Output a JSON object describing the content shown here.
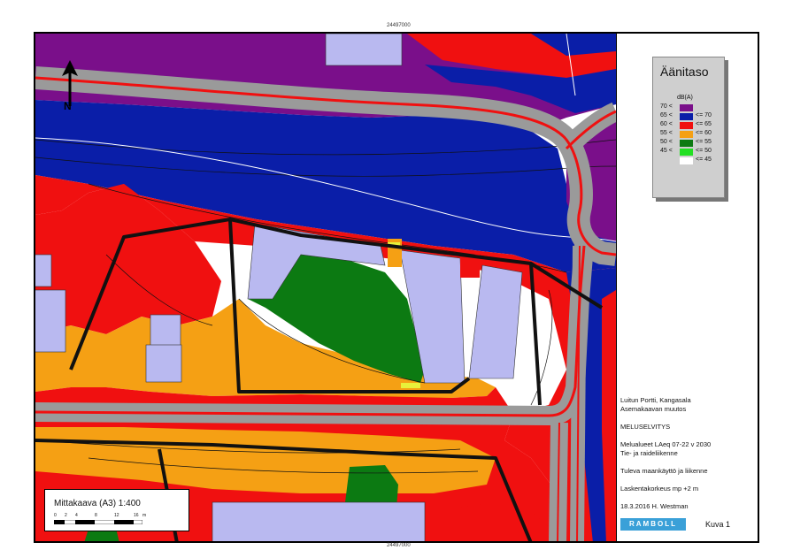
{
  "coord_label_top": "24497000",
  "coord_label_bottom": "24497000",
  "legend": {
    "title": "Äänitaso",
    "unit": "dB(A)",
    "classes": [
      {
        "low": "70 <",
        "high": "",
        "color": "#7a0f8a"
      },
      {
        "low": "65 <",
        "high": "<= 70",
        "color": "#0a1ea8"
      },
      {
        "low": "60 <",
        "high": "<= 65",
        "color": "#f01010"
      },
      {
        "low": "55 <",
        "high": "<= 60",
        "color": "#f5a014"
      },
      {
        "low": "50 <",
        "high": "<= 55",
        "color": "#0c7a12"
      },
      {
        "low": "45 <",
        "high": "<= 50",
        "color": "#22e022"
      },
      {
        "low": "",
        "high": "<= 45",
        "color": "#ffffff"
      }
    ]
  },
  "info": {
    "line1": "Luitun Portti, Kangasala",
    "line2": "Asemakaavan muutos",
    "line3": "MELUSELVITYS",
    "line4": "Melualueet LAeq 07-22 v 2030",
    "line5": "Tie- ja raideliikenne",
    "line6": "Tuleva maankäyttö ja liikenne",
    "line7": "Laskentakorkeus mp +2 m",
    "line8": "18.3.2016 H. Westman",
    "logo": "RAMBOLL",
    "figure": "Kuva 1"
  },
  "scale": {
    "label": "Mittakaava (A3) 1:400",
    "ticks": [
      "0",
      "2",
      "4",
      "8",
      "12",
      "16"
    ],
    "unit": "m"
  },
  "north_label": "N",
  "colors": {
    "purple": "#7a0f8a",
    "blue": "#0a1ea8",
    "red": "#f01010",
    "orange": "#f5a014",
    "green": "#0c7a12",
    "lightgreen": "#22e022",
    "road": "#9a9a9a",
    "building": "#b9b9f0"
  }
}
